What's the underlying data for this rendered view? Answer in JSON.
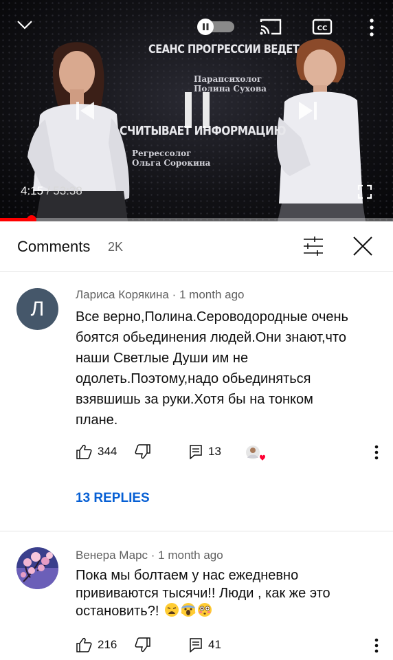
{
  "player": {
    "video_title_top": "СЕАНС ПРОГРЕССИИ ВЕДЕТ",
    "video_title_bottom": "СЧИТЫВАЕТ ИНФОРМАЦИЮ",
    "caption_a_line1": "Парапсихолог",
    "caption_a_line2": "Полина Сухова",
    "caption_b_line1": "Регрессолог",
    "caption_b_line2": "Ольга Сорокина",
    "current_time": "4:15",
    "separator": " / ",
    "duration": "53:38",
    "progress_fraction": 0.08,
    "autoplay_toggle": "paused",
    "icons": [
      "chevron-down-icon",
      "autoplay-toggle-icon",
      "cast-icon",
      "captions-icon",
      "more-vert-icon",
      "previous-icon",
      "pause-icon",
      "next-icon",
      "fullscreen-icon"
    ],
    "accent_color": "#ff0000"
  },
  "comments_header": {
    "title": "Comments",
    "count": "2K"
  },
  "comments": [
    {
      "avatar_letter": "Л",
      "avatar_color": "#45576a",
      "author": "Лариса Корякина",
      "dot": "·",
      "time": "1 month ago",
      "text_lines": [
        "Все верно,Полина.Сероводородные очень",
        "боятся обьединения людей.Они знают,что",
        "наши Светлые Души им не",
        "одолеть.Поэтому,надо обьединяться",
        "взявшишь за руки.Хотя бы на тонком",
        "плане."
      ],
      "likes": "344",
      "reply_count": "13",
      "replies_label": "13 REPLIES"
    },
    {
      "avatar_image": "cherry-blossom",
      "author": "Венера Марс",
      "dot": "·",
      "time": "1 month ago",
      "text_lines": [
        "Пока мы болтаем у нас ежедневно",
        "прививаются тысячи!! Люди , как же это",
        "остановить?!"
      ],
      "emojis": [
        "weary-face",
        "screaming-face",
        "flushed-face"
      ],
      "likes": "216",
      "reply_count": "41"
    }
  ]
}
